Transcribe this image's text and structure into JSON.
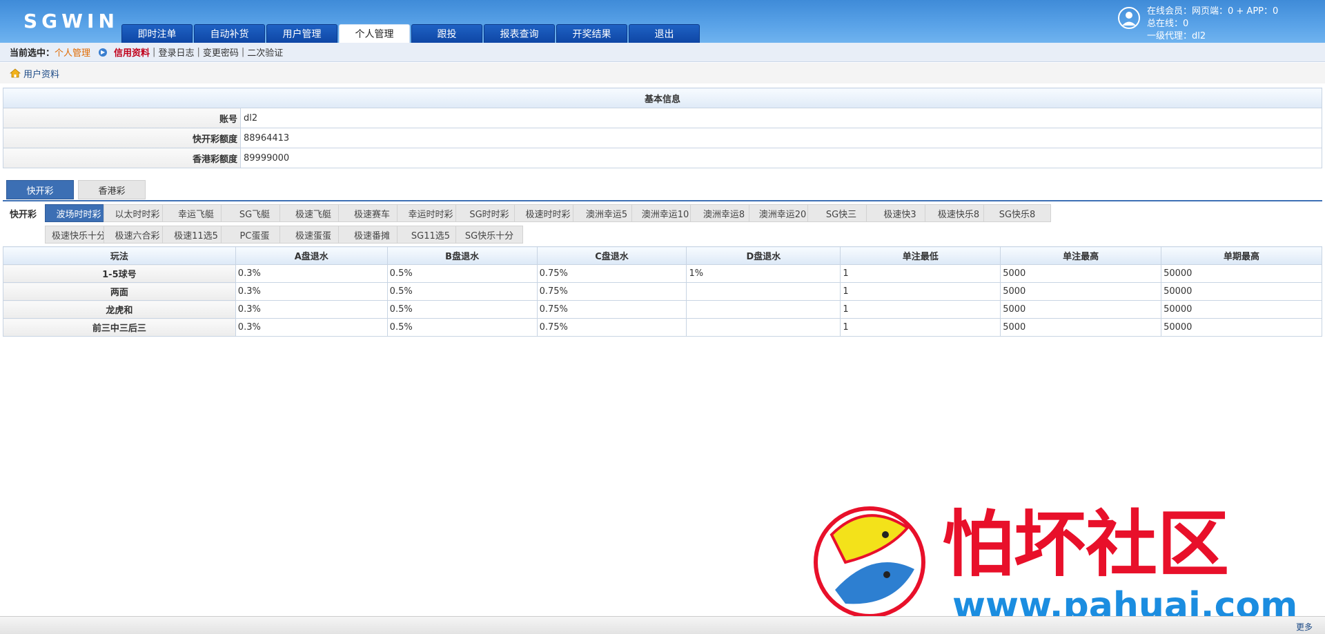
{
  "header": {
    "logo": "SGWIN",
    "nav": [
      "即时注单",
      "自动补货",
      "用户管理",
      "个人管理",
      "跟投",
      "报表查询",
      "开奖结果",
      "退出"
    ],
    "active_nav": 3,
    "online_line1": "在线会员：网页端：0 + APP：0",
    "online_line2": "总在线：0",
    "online_line3": "一级代理：dl2"
  },
  "crumb": {
    "label": "当前选中：",
    "current": "个人管理",
    "links": [
      "信用资料",
      "登录日志",
      "变更密码",
      "二次验证"
    ]
  },
  "sub_title": "用户资料",
  "info": {
    "title": "基本信息",
    "rows": [
      {
        "k": "账号",
        "v": "dl2"
      },
      {
        "k": "快开彩额度",
        "v": "88964413"
      },
      {
        "k": "香港彩额度",
        "v": "89999000"
      }
    ]
  },
  "cat_tabs": [
    "快开彩",
    "香港彩"
  ],
  "games_label": "快开彩",
  "games_row1": [
    "波场时时彩",
    "以太时时彩",
    "幸运飞艇",
    "SG飞艇",
    "极速飞艇",
    "极速赛车",
    "幸运时时彩",
    "SG时时彩",
    "极速时时彩",
    "澳洲幸运5",
    "澳洲幸运10",
    "澳洲幸运8",
    "澳洲幸运20",
    "SG快三",
    "极速快3",
    "极速快乐8",
    "SG快乐8"
  ],
  "games_row2": [
    "极速快乐十分",
    "极速六合彩",
    "极速11选5",
    "PC蛋蛋",
    "极速蛋蛋",
    "极速番摊",
    "SG11选5",
    "SG快乐十分"
  ],
  "rates": {
    "headers": [
      "玩法",
      "A盘退水",
      "B盘退水",
      "C盘退水",
      "D盘退水",
      "单注最低",
      "单注最高",
      "单期最高"
    ],
    "rows": [
      [
        "1-5球号",
        "0.3%",
        "0.5%",
        "0.75%",
        "1%",
        "1",
        "5000",
        "50000"
      ],
      [
        "两面",
        "0.3%",
        "0.5%",
        "0.75%",
        "",
        "1",
        "5000",
        "50000"
      ],
      [
        "龙虎和",
        "0.3%",
        "0.5%",
        "0.75%",
        "",
        "1",
        "5000",
        "50000"
      ],
      [
        "前三中三后三",
        "0.3%",
        "0.5%",
        "0.75%",
        "",
        "1",
        "5000",
        "50000"
      ]
    ]
  },
  "watermark": {
    "cn": "怕坏社区",
    "url": "www.pahuai.com"
  },
  "footer_more": "更多"
}
